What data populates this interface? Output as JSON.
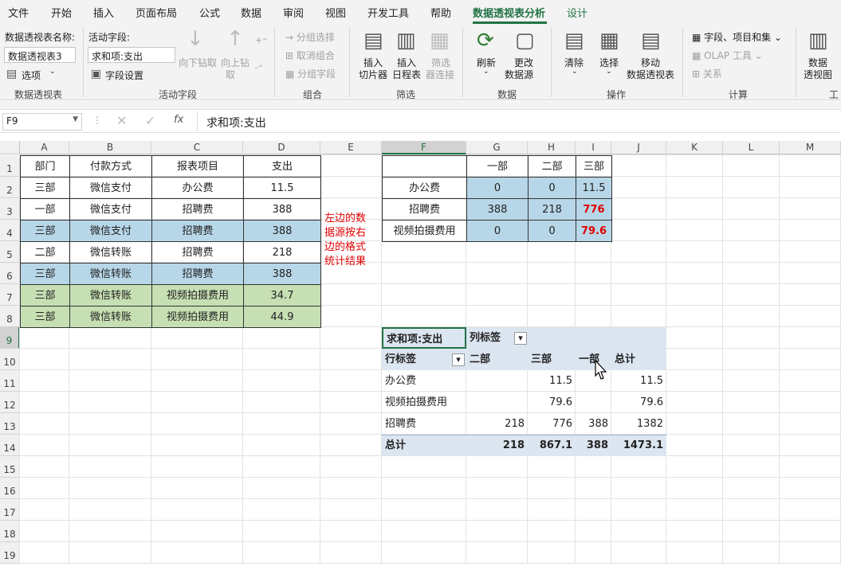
{
  "menu": {
    "tabs": [
      "文件",
      "开始",
      "插入",
      "页面布局",
      "公式",
      "数据",
      "审阅",
      "视图",
      "开发工具",
      "帮助",
      "数据透视表分析",
      "设计"
    ]
  },
  "ribbon": {
    "pt_name_label": "数据透视表名称:",
    "pt_name_value": "数据透视表3",
    "options_label": "选项",
    "group_pivot": "数据透视表",
    "active_field_label": "活动字段:",
    "active_field_value": "求和项:支出",
    "field_settings": "字段设置",
    "drill_down": "向下钻取",
    "drill_up": "向上钻",
    "drill_up2": "取",
    "group_active": "活动字段",
    "group_sel": "分组选择",
    "ungroup": "取消组合",
    "group_field": "分组字段",
    "group_group": "组合",
    "insert_slicer": [
      "插入",
      "切片器"
    ],
    "insert_timeline": [
      "插入",
      "日程表"
    ],
    "filter_conn": [
      "筛选",
      "器连接"
    ],
    "group_filter": "筛选",
    "refresh": "刷新",
    "change_source": [
      "更改",
      "数据源"
    ],
    "group_data": "数据",
    "clear": "清除",
    "select": "选择",
    "move_pt": [
      "移动",
      "数据透视表"
    ],
    "group_ops": "操作",
    "fields_items": "字段、项目和集",
    "olap": "OLAP 工具",
    "relations": "关系",
    "group_calc": "计算",
    "pivot_chart": [
      "数据",
      "透视图"
    ],
    "group_tools": "工"
  },
  "formula_bar": {
    "name_box": "F9",
    "formula": "求和项:支出"
  },
  "columns": [
    "A",
    "B",
    "C",
    "D",
    "E",
    "F",
    "G",
    "H",
    "I",
    "J",
    "K",
    "L",
    "M"
  ],
  "rows": [
    "1",
    "2",
    "3",
    "4",
    "5",
    "6",
    "7",
    "8",
    "9",
    "10",
    "11",
    "12",
    "13",
    "14",
    "15",
    "16",
    "17",
    "18",
    "19"
  ],
  "source_table": {
    "headers": [
      "部门",
      "付款方式",
      "报表项目",
      "支出"
    ],
    "rows": [
      [
        "三部",
        "微信支付",
        "办公费",
        "11.5"
      ],
      [
        "一部",
        "微信支付",
        "招聘费",
        "388"
      ],
      [
        "三部",
        "微信支付",
        "招聘费",
        "388"
      ],
      [
        "二部",
        "微信转账",
        "招聘费",
        "218"
      ],
      [
        "三部",
        "微信转账",
        "招聘费",
        "388"
      ],
      [
        "三部",
        "微信转账",
        "视频拍摄费用",
        "34.7"
      ],
      [
        "三部",
        "微信转账",
        "视频拍摄费用",
        "44.9"
      ]
    ]
  },
  "note": "左边的数据源按右边的格式统计结果",
  "target_table": {
    "headers": [
      "",
      "一部",
      "二部",
      "三部"
    ],
    "rows": [
      [
        "办公费",
        "0",
        "0",
        "11.5"
      ],
      [
        "招聘费",
        "388",
        "218",
        "776"
      ],
      [
        "视频拍摄费用",
        "0",
        "0",
        "79.6"
      ]
    ]
  },
  "pivot": {
    "value_field": "求和项:支出",
    "col_label": "列标签",
    "row_label": "行标签",
    "col_headers": [
      "二部",
      "三部",
      "一部",
      "总计"
    ],
    "rows": [
      [
        "办公费",
        "",
        "11.5",
        "",
        "11.5"
      ],
      [
        "视频拍摄费用",
        "",
        "79.6",
        "",
        "79.6"
      ],
      [
        "招聘费",
        "218",
        "776",
        "388",
        "1382"
      ]
    ],
    "total": [
      "总计",
      "218",
      "867.1",
      "388",
      "1473.1"
    ]
  },
  "colors": {
    "accent": "#217346",
    "highlight_blue": "#b7d7e8",
    "highlight_green": "#c6e0b4",
    "pivot_header": "#dce6f1",
    "red": "#e00000"
  }
}
